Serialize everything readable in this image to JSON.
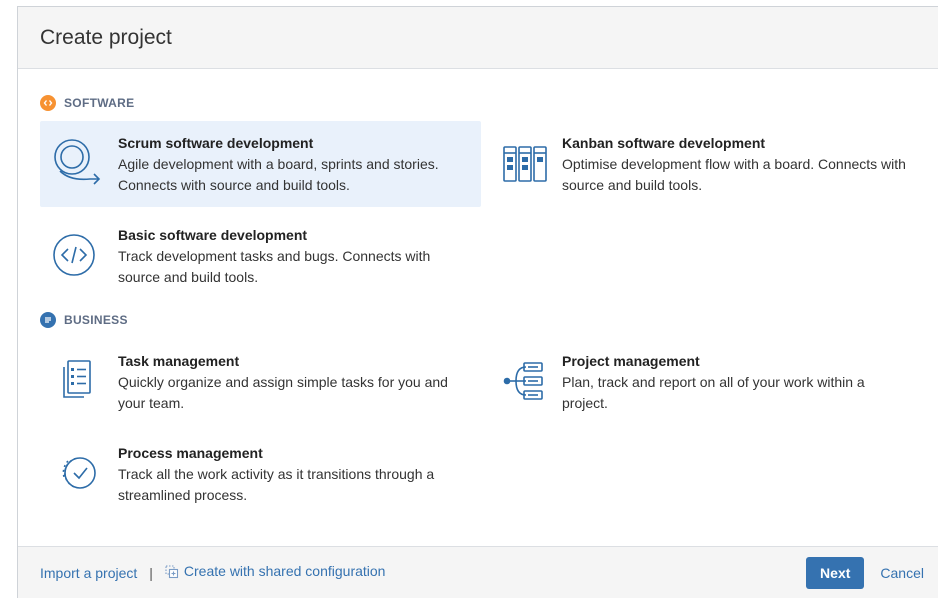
{
  "dialog": {
    "title": "Create project"
  },
  "sections": {
    "software": {
      "label": "SOFTWARE",
      "color": "#f79232"
    },
    "business": {
      "label": "BUSINESS",
      "color": "#3572b0"
    }
  },
  "templates": {
    "scrum": {
      "title": "Scrum software development",
      "desc": "Agile development with a board, sprints and stories. Connects with source and build tools.",
      "icon": "scrum-cycle-icon"
    },
    "kanban": {
      "title": "Kanban software development",
      "desc": "Optimise development flow with a board. Connects with source and build tools.",
      "icon": "kanban-board-icon"
    },
    "basic": {
      "title": "Basic software development",
      "desc": "Track development tasks and bugs. Connects with source and build tools.",
      "icon": "code-brackets-icon"
    },
    "task": {
      "title": "Task management",
      "desc": "Quickly organize and assign simple tasks for you and your team.",
      "icon": "task-list-icon"
    },
    "project": {
      "title": "Project management",
      "desc": "Plan, track and report on all of your work within a project.",
      "icon": "project-hierarchy-icon"
    },
    "process": {
      "title": "Process management",
      "desc": "Track all the work activity as it transitions through a streamlined process.",
      "icon": "process-check-icon"
    }
  },
  "footer": {
    "import_label": "Import a project",
    "separator": "|",
    "shared_label": "Create with shared configuration",
    "next_label": "Next",
    "cancel_label": "Cancel"
  },
  "colors": {
    "accent": "#3572b0",
    "icon_blue": "#2d6ca8",
    "selected_bg": "#e9f1fb"
  }
}
